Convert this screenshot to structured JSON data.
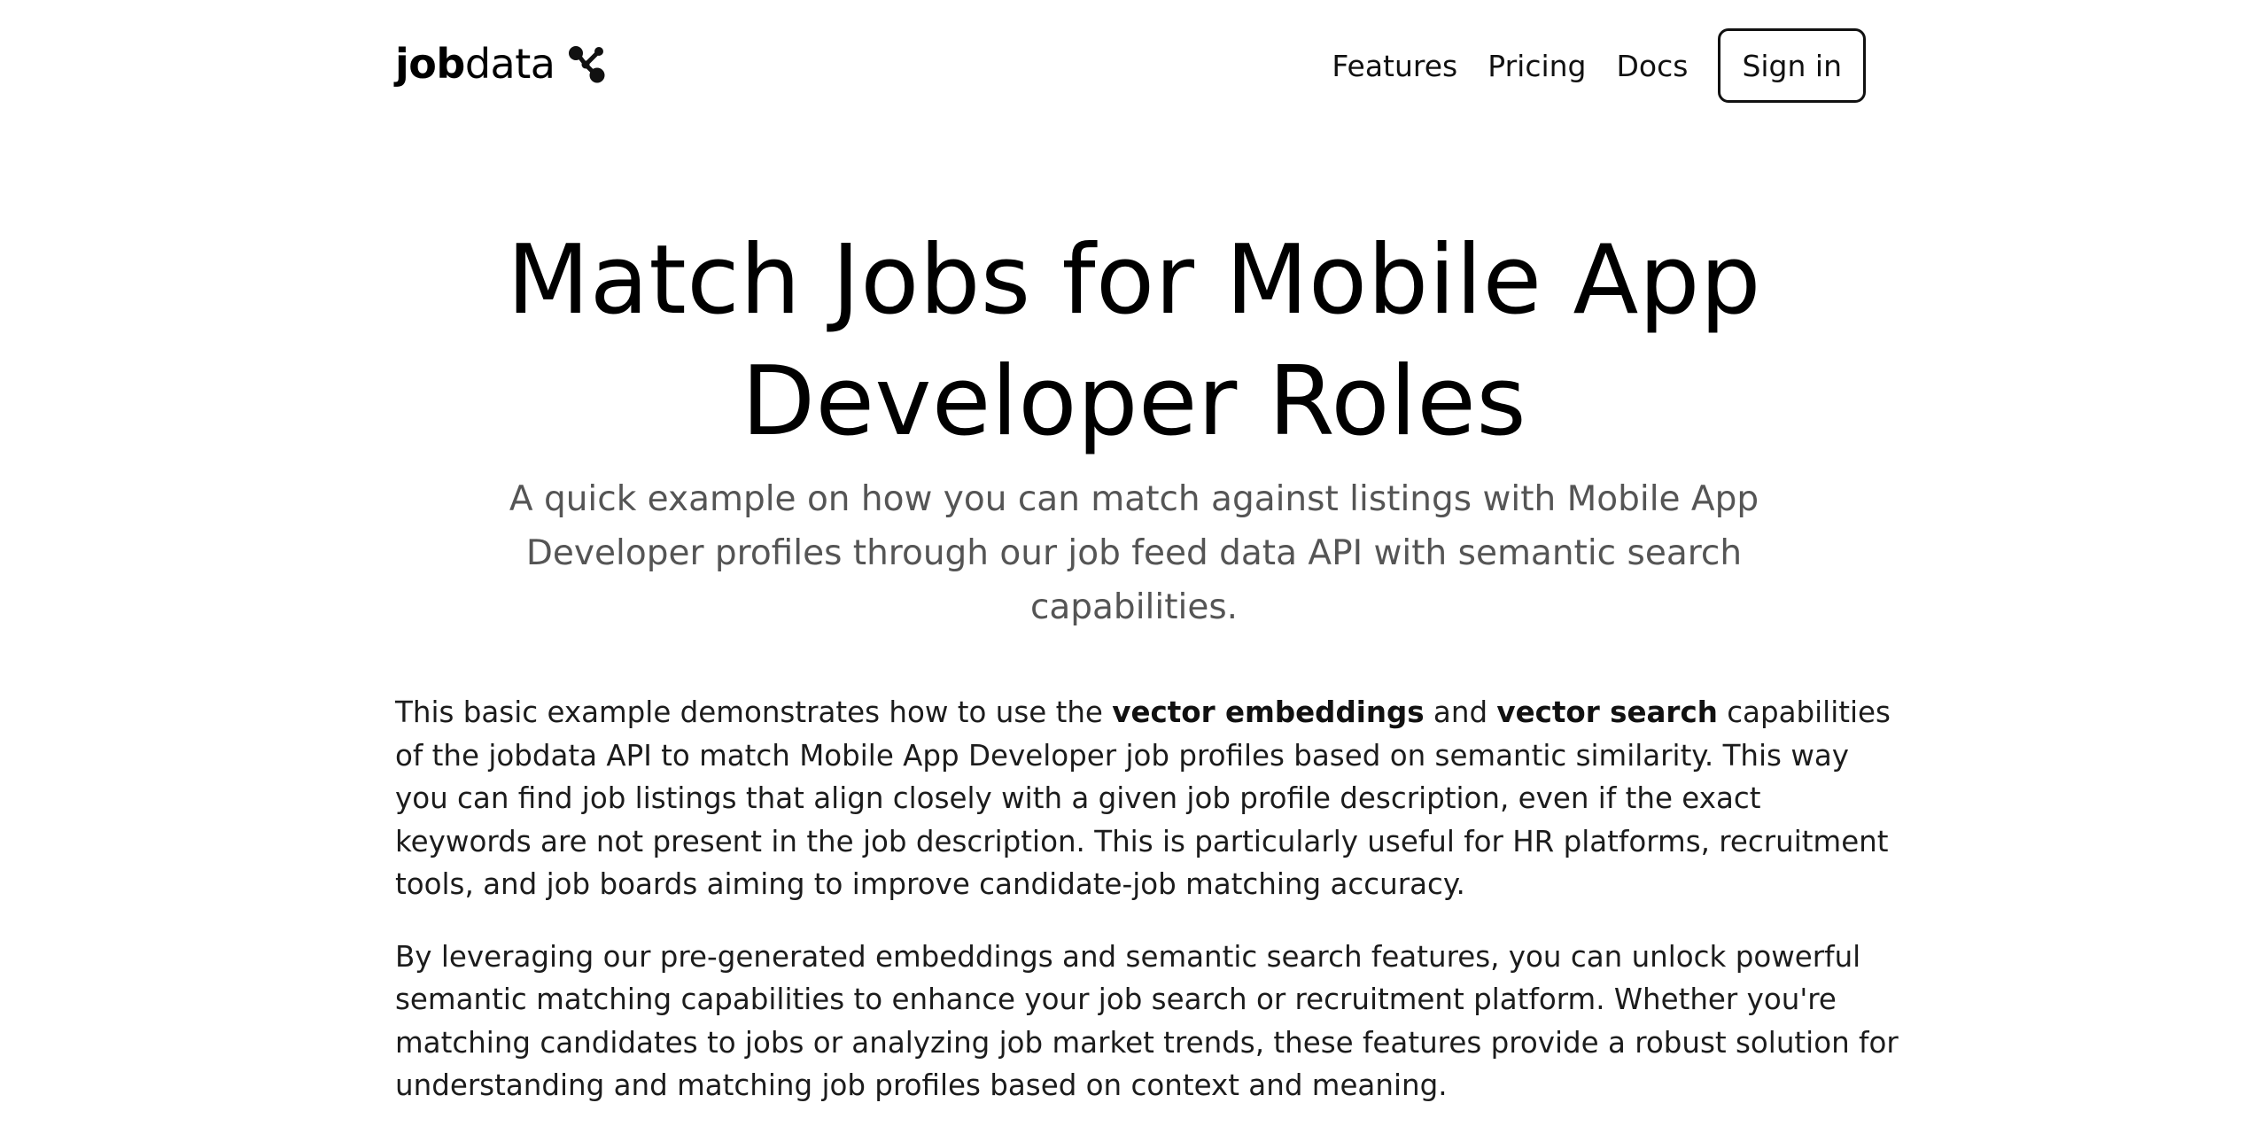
{
  "brand": {
    "name_bold": "job",
    "name_light": "data",
    "logo_icon": "molecule-icon"
  },
  "nav": {
    "features": "Features",
    "pricing": "Pricing",
    "docs": "Docs",
    "sign_in": "Sign in"
  },
  "hero": {
    "title": "Match Jobs for Mobile App Developer Roles",
    "subtitle": "A quick example on how you can match against listings with Mobile App Developer profiles through our job feed data API with semantic search capabilities."
  },
  "content": {
    "p1": {
      "t1": "This basic example demonstrates how to use the ",
      "b1": "vector embeddings",
      "t2": " and ",
      "b2": "vector search",
      "t3": " capabilities of the jobdata API to match Mobile App Developer job profiles based on semantic similarity. This way you can find job listings that align closely with a given job profile description, even if the exact keywords are not present in the job description. This is particularly useful for HR platforms, recruitment tools, and job boards aiming to improve candidate-job matching accuracy."
    },
    "p2": "By leveraging our pre-generated embeddings and semantic search features, you can unlock powerful semantic matching capabilities to enhance your job search or recruitment platform. Whether you're matching candidates to jobs or analyzing job market trends, these features provide a robust solution for understanding and matching job profiles based on context and meaning."
  },
  "colors": {
    "text": "#111111",
    "subtitle": "#555555",
    "background": "#ffffff",
    "border": "#111111"
  }
}
